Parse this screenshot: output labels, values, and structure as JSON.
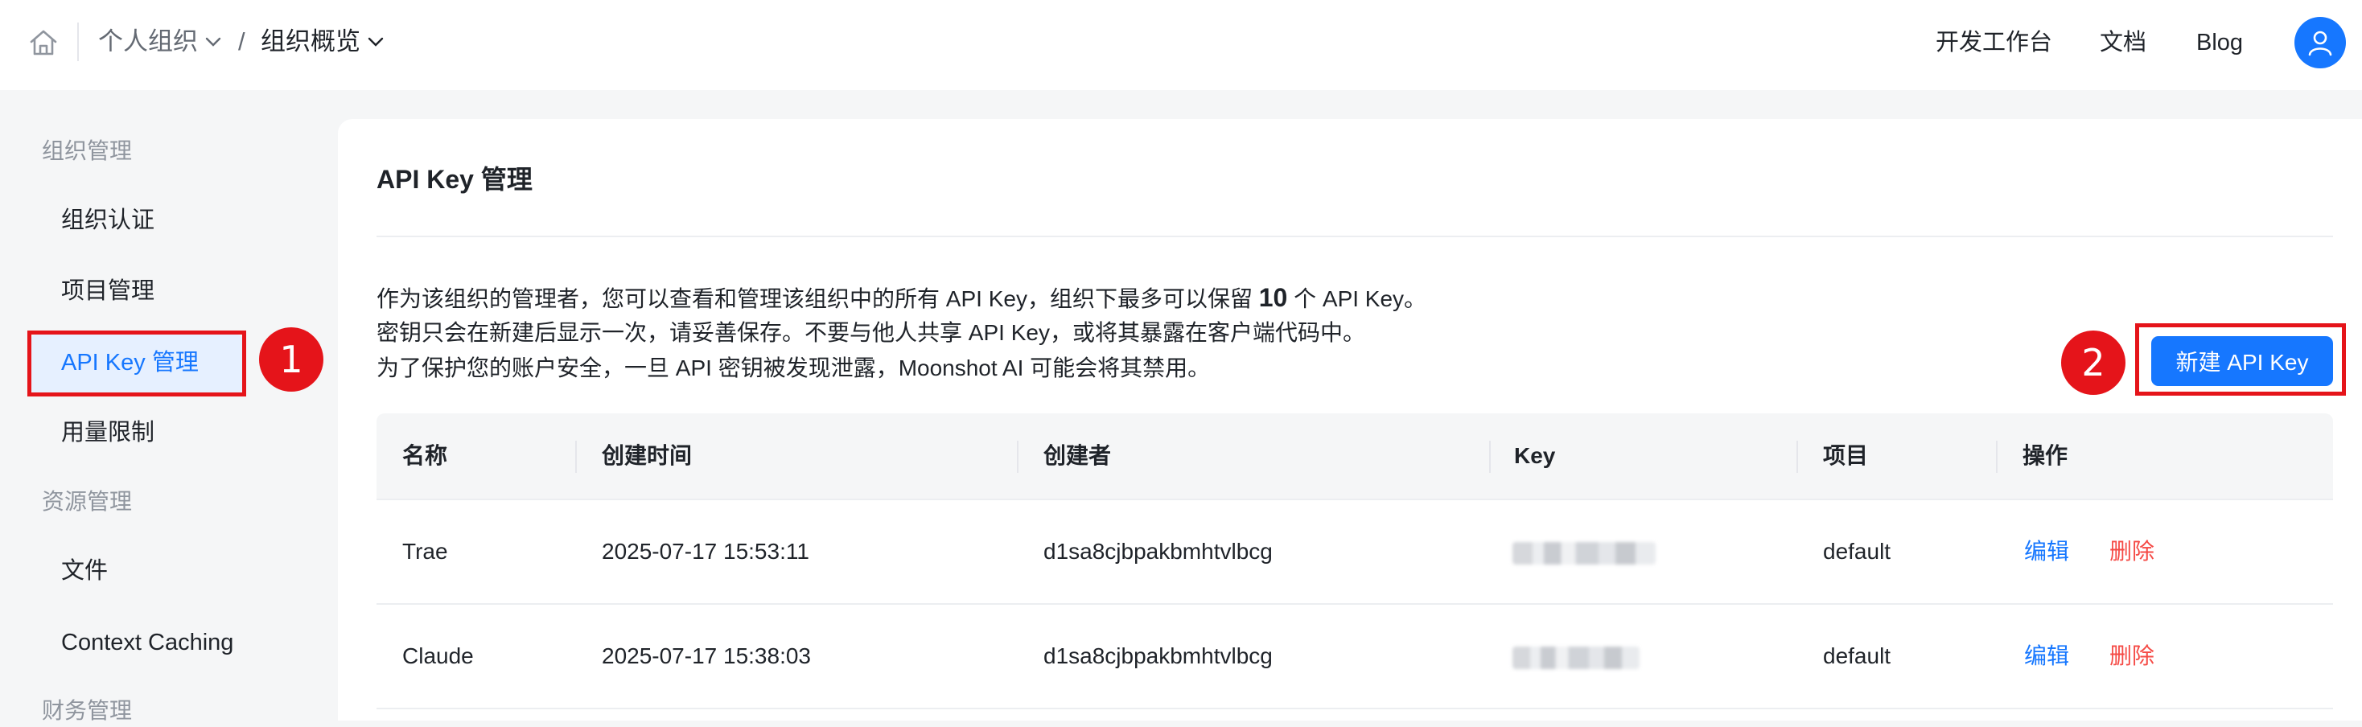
{
  "header": {
    "org_crumb": "个人组织",
    "slash": "/",
    "page_crumb": "组织概览",
    "nav": {
      "dev": "开发工作台",
      "docs": "文档",
      "blog": "Blog"
    }
  },
  "sidebar": {
    "groups": [
      {
        "label": "组织管理",
        "items": [
          "组织认证",
          "项目管理",
          "API Key 管理",
          "用量限制"
        ]
      },
      {
        "label": "资源管理",
        "items": [
          "文件",
          "Context Caching"
        ]
      },
      {
        "label": "财务管理",
        "items": []
      }
    ],
    "active_item": "API Key 管理"
  },
  "annotations": {
    "marker_1": "1",
    "marker_2": "2"
  },
  "main": {
    "title": "API Key 管理",
    "desc_line1_pre": "作为该组织的管理者，您可以查看和管理该组织中的所有 API Key，组织下最多可以保留 ",
    "desc_line1_num": "10",
    "desc_line1_post": " 个 API Key。",
    "desc_line2": "密钥只会在新建后显示一次，请妥善保存。不要与他人共享 API Key，或将其暴露在客户端代码中。",
    "desc_line3": "为了保护您的账户安全，一旦 API 密钥被发现泄露，Moonshot AI 可能会将其禁用。",
    "new_button": "新建 API Key"
  },
  "table": {
    "columns": [
      "名称",
      "创建时间",
      "创建者",
      "Key",
      "项目",
      "操作"
    ],
    "rows": [
      {
        "name": "Trae",
        "created": "2025-07-17 15:53:11",
        "creator": "d1sa8cjbpakbmhtvlbcg",
        "project": "default",
        "edit": "编辑",
        "delete": "删除"
      },
      {
        "name": "Claude",
        "created": "2025-07-17 15:38:03",
        "creator": "d1sa8cjbpakbmhtvlbcg",
        "project": "default",
        "edit": "编辑",
        "delete": "删除"
      }
    ]
  },
  "colors": {
    "accent": "#1677ff",
    "danger": "#f54a45",
    "annotation": "#e5141a"
  }
}
